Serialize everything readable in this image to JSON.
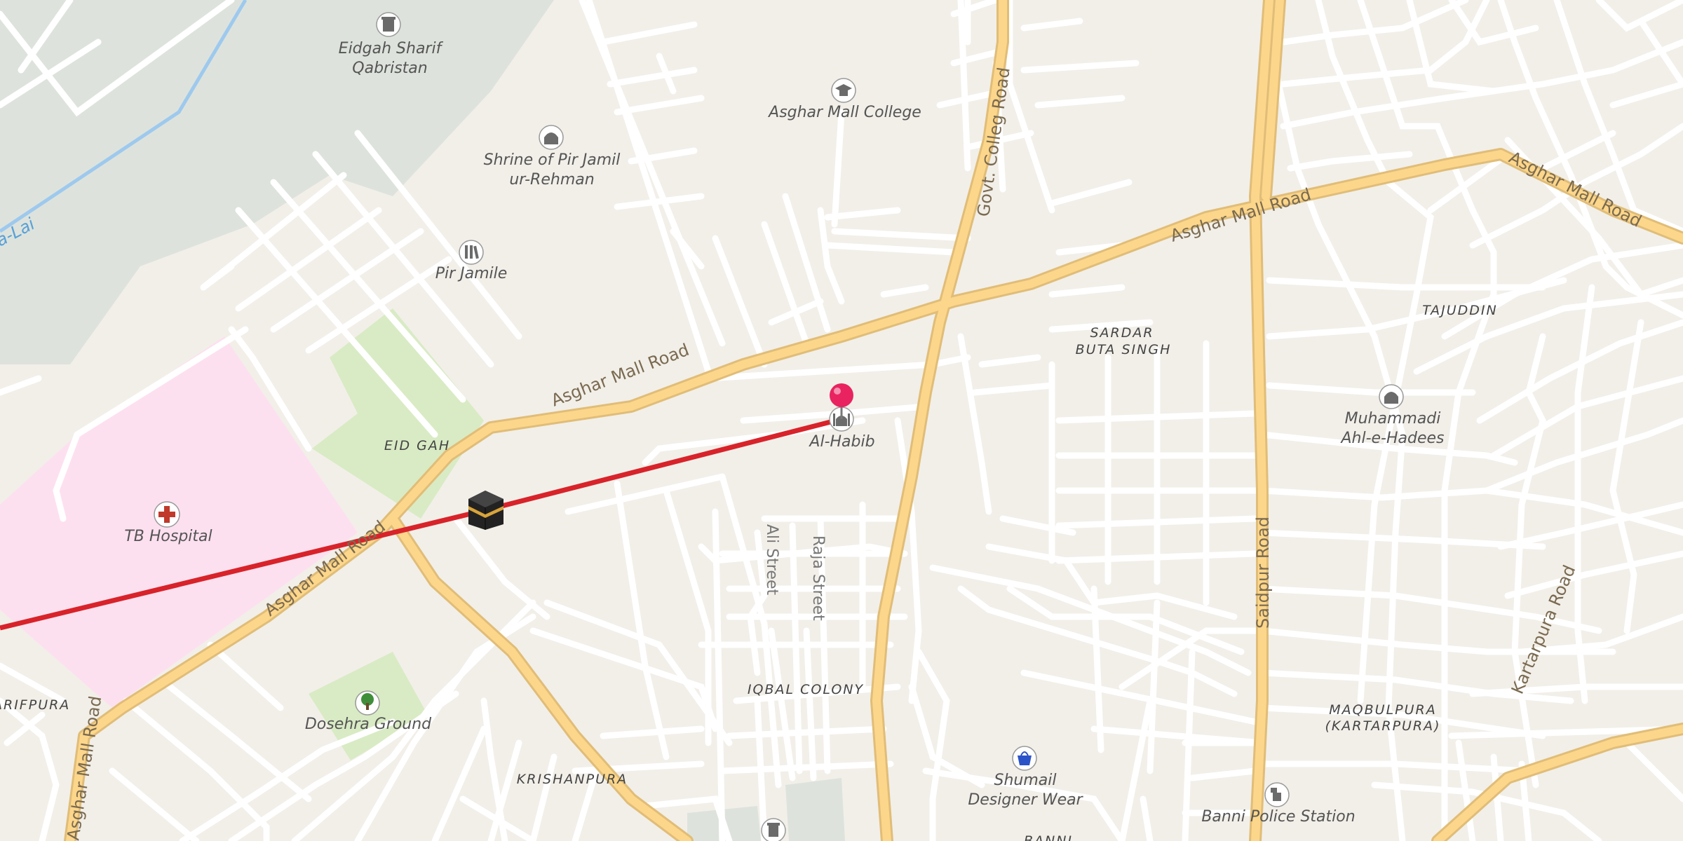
{
  "map": {
    "colors": {
      "background": "#f2efe9",
      "minor_road": "#ffffff",
      "major_road_fill": "#fcd68a",
      "major_road_casing": "#e6c27a",
      "hospital_area": "#fde0ef",
      "park_area": "#d9ebc4",
      "cemetery_area": "#dde3dc",
      "river": "#9ec9ee",
      "route_line": "#d8232a",
      "pin": "#e8235f"
    },
    "roads": {
      "asghar_mall_road_1": "Asghar Mall Road",
      "asghar_mall_road_2": "Asghar Mall Road",
      "asghar_mall_road_3": "Asghar Mall Road",
      "asghar_mall_road_4": "Asghar Mall Road",
      "asghar_mall_road_5": "Asghar Mall Road",
      "govt_colleg_road": "Govt. Colleg Road",
      "saidpur_road": "Saidpur Road",
      "kartarpura_road": "Kartarpura Road",
      "ali_street": "Ali Street",
      "raja_street": "Raja Street"
    },
    "water": {
      "river_label": "a-Lai"
    },
    "areas": {
      "eid_gah": "EID GAH",
      "sardar_buta_singh_1": "SARDAR",
      "sardar_buta_singh_2": "BUTA SINGH",
      "tajuddin": "TAJUDDIN",
      "iqbal_colony": "IQBAL COLONY",
      "maqbulpura_1": "MAQBULPURA",
      "maqbulpura_2": "(KARTARPURA)",
      "krishanpura": "KRISHANPURA",
      "arifpura": "ARIFPURA",
      "banni": "BANNI"
    },
    "pois": {
      "eidgah_sharif_1": "Eidgah Sharif",
      "eidgah_sharif_2": "Qabristan",
      "asghar_mall_college": "Asghar Mall College",
      "shrine_1": "Shrine of Pir Jamil",
      "shrine_2": "ur-Rehman",
      "pir_jamile": "Pir Jamile",
      "al_habib": "Al-Habib",
      "tb_hospital": "TB Hospital",
      "dosehra_ground": "Dosehra Ground",
      "muhammadi_1": "Muhammadi",
      "muhammadi_2": "Ahl-e-Hadees",
      "shumail_1": "Shumail",
      "shumail_2": "Designer Wear",
      "banni_police": "Banni Police Station"
    },
    "icons": {
      "cemetery": "cemetery-icon",
      "college": "graduation-cap-icon",
      "shrine": "shrine-icon",
      "library": "books-icon",
      "mosque": "mosque-icon",
      "hospital": "hospital-cross-icon",
      "park": "tree-icon",
      "shop": "shopping-bag-icon",
      "police": "police-icon",
      "kaaba": "kaaba-icon",
      "pin": "map-pin-icon"
    }
  }
}
